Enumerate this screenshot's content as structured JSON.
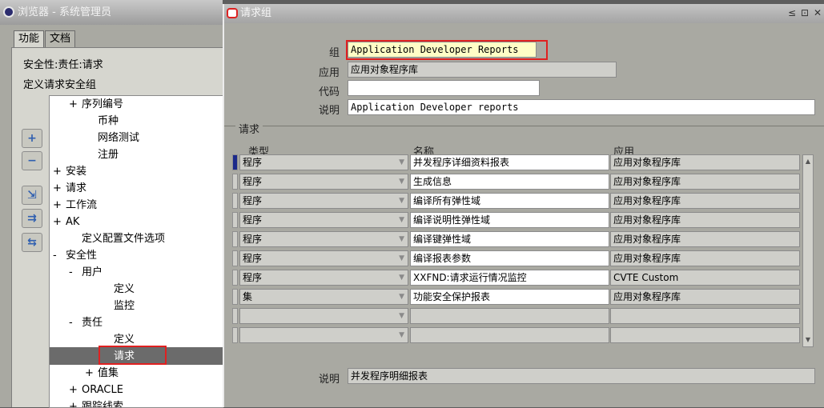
{
  "navigator": {
    "title": "浏览器 - 系统管理员",
    "tabs": [
      "功能",
      "文档"
    ],
    "line1": "安全性:责任:请求",
    "line2": "定义请求安全组",
    "tree": [
      {
        "sym": "+",
        "label": "序列编号",
        "indent": 1
      },
      {
        "sym": "",
        "label": "币种",
        "indent": 2
      },
      {
        "sym": "",
        "label": "网络测试",
        "indent": 2
      },
      {
        "sym": "",
        "label": "注册",
        "indent": 2
      },
      {
        "sym": "+",
        "label": "安装",
        "indent": 0
      },
      {
        "sym": "+",
        "label": "请求",
        "indent": 0
      },
      {
        "sym": "+",
        "label": "工作流",
        "indent": 0
      },
      {
        "sym": "+",
        "label": "AK",
        "indent": 0
      },
      {
        "sym": "",
        "label": "定义配置文件选项",
        "indent": 1
      },
      {
        "sym": "-",
        "label": "安全性",
        "indent": 0
      },
      {
        "sym": "-",
        "label": "用户",
        "indent": 1
      },
      {
        "sym": "",
        "label": "定义",
        "indent": 3
      },
      {
        "sym": "",
        "label": "监控",
        "indent": 3
      },
      {
        "sym": "-",
        "label": "责任",
        "indent": 1
      },
      {
        "sym": "",
        "label": "定义",
        "indent": 3
      },
      {
        "sym": "",
        "label": "请求",
        "indent": 3
      },
      {
        "sym": "+",
        "label": "值集",
        "indent": 2
      },
      {
        "sym": "+",
        "label": "ORACLE",
        "indent": 1
      },
      {
        "sym": "+",
        "label": "跟踪线索",
        "indent": 1
      }
    ],
    "buttons": [
      "+",
      "−",
      "⇲",
      "⇉",
      "⇆"
    ]
  },
  "form": {
    "title": "请求组",
    "controls": [
      "≤",
      "⊡",
      "✕"
    ],
    "group_label": "组",
    "group_value": "Application Developer Reports",
    "app_label": "应用",
    "app_value": "应用对象程序库",
    "code_label": "代码",
    "code_value": "",
    "desc_label": "说明",
    "desc_value": "Application Developer reports",
    "section_title": "请求",
    "col_type": "类型",
    "col_name": "名称",
    "col_app": "应用",
    "rows": [
      {
        "type": "程序",
        "name": "并发程序详细资料报表",
        "app": "应用对象程序库"
      },
      {
        "type": "程序",
        "name": "生成信息",
        "app": "应用对象程序库"
      },
      {
        "type": "程序",
        "name": "编译所有弹性域",
        "app": "应用对象程序库"
      },
      {
        "type": "程序",
        "name": "编译说明性弹性域",
        "app": "应用对象程序库"
      },
      {
        "type": "程序",
        "name": "编译键弹性域",
        "app": "应用对象程序库"
      },
      {
        "type": "程序",
        "name": "编译报表参数",
        "app": "应用对象程序库"
      },
      {
        "type": "程序",
        "name": "XXFND:请求运行情况监控",
        "app": "CVTE Custom"
      },
      {
        "type": "集",
        "name": "功能安全保护报表",
        "app": "应用对象程序库"
      },
      {
        "type": "",
        "name": "",
        "app": ""
      },
      {
        "type": "",
        "name": "",
        "app": ""
      }
    ],
    "footer_label": "说明",
    "footer_value": "并发程序明细报表"
  }
}
